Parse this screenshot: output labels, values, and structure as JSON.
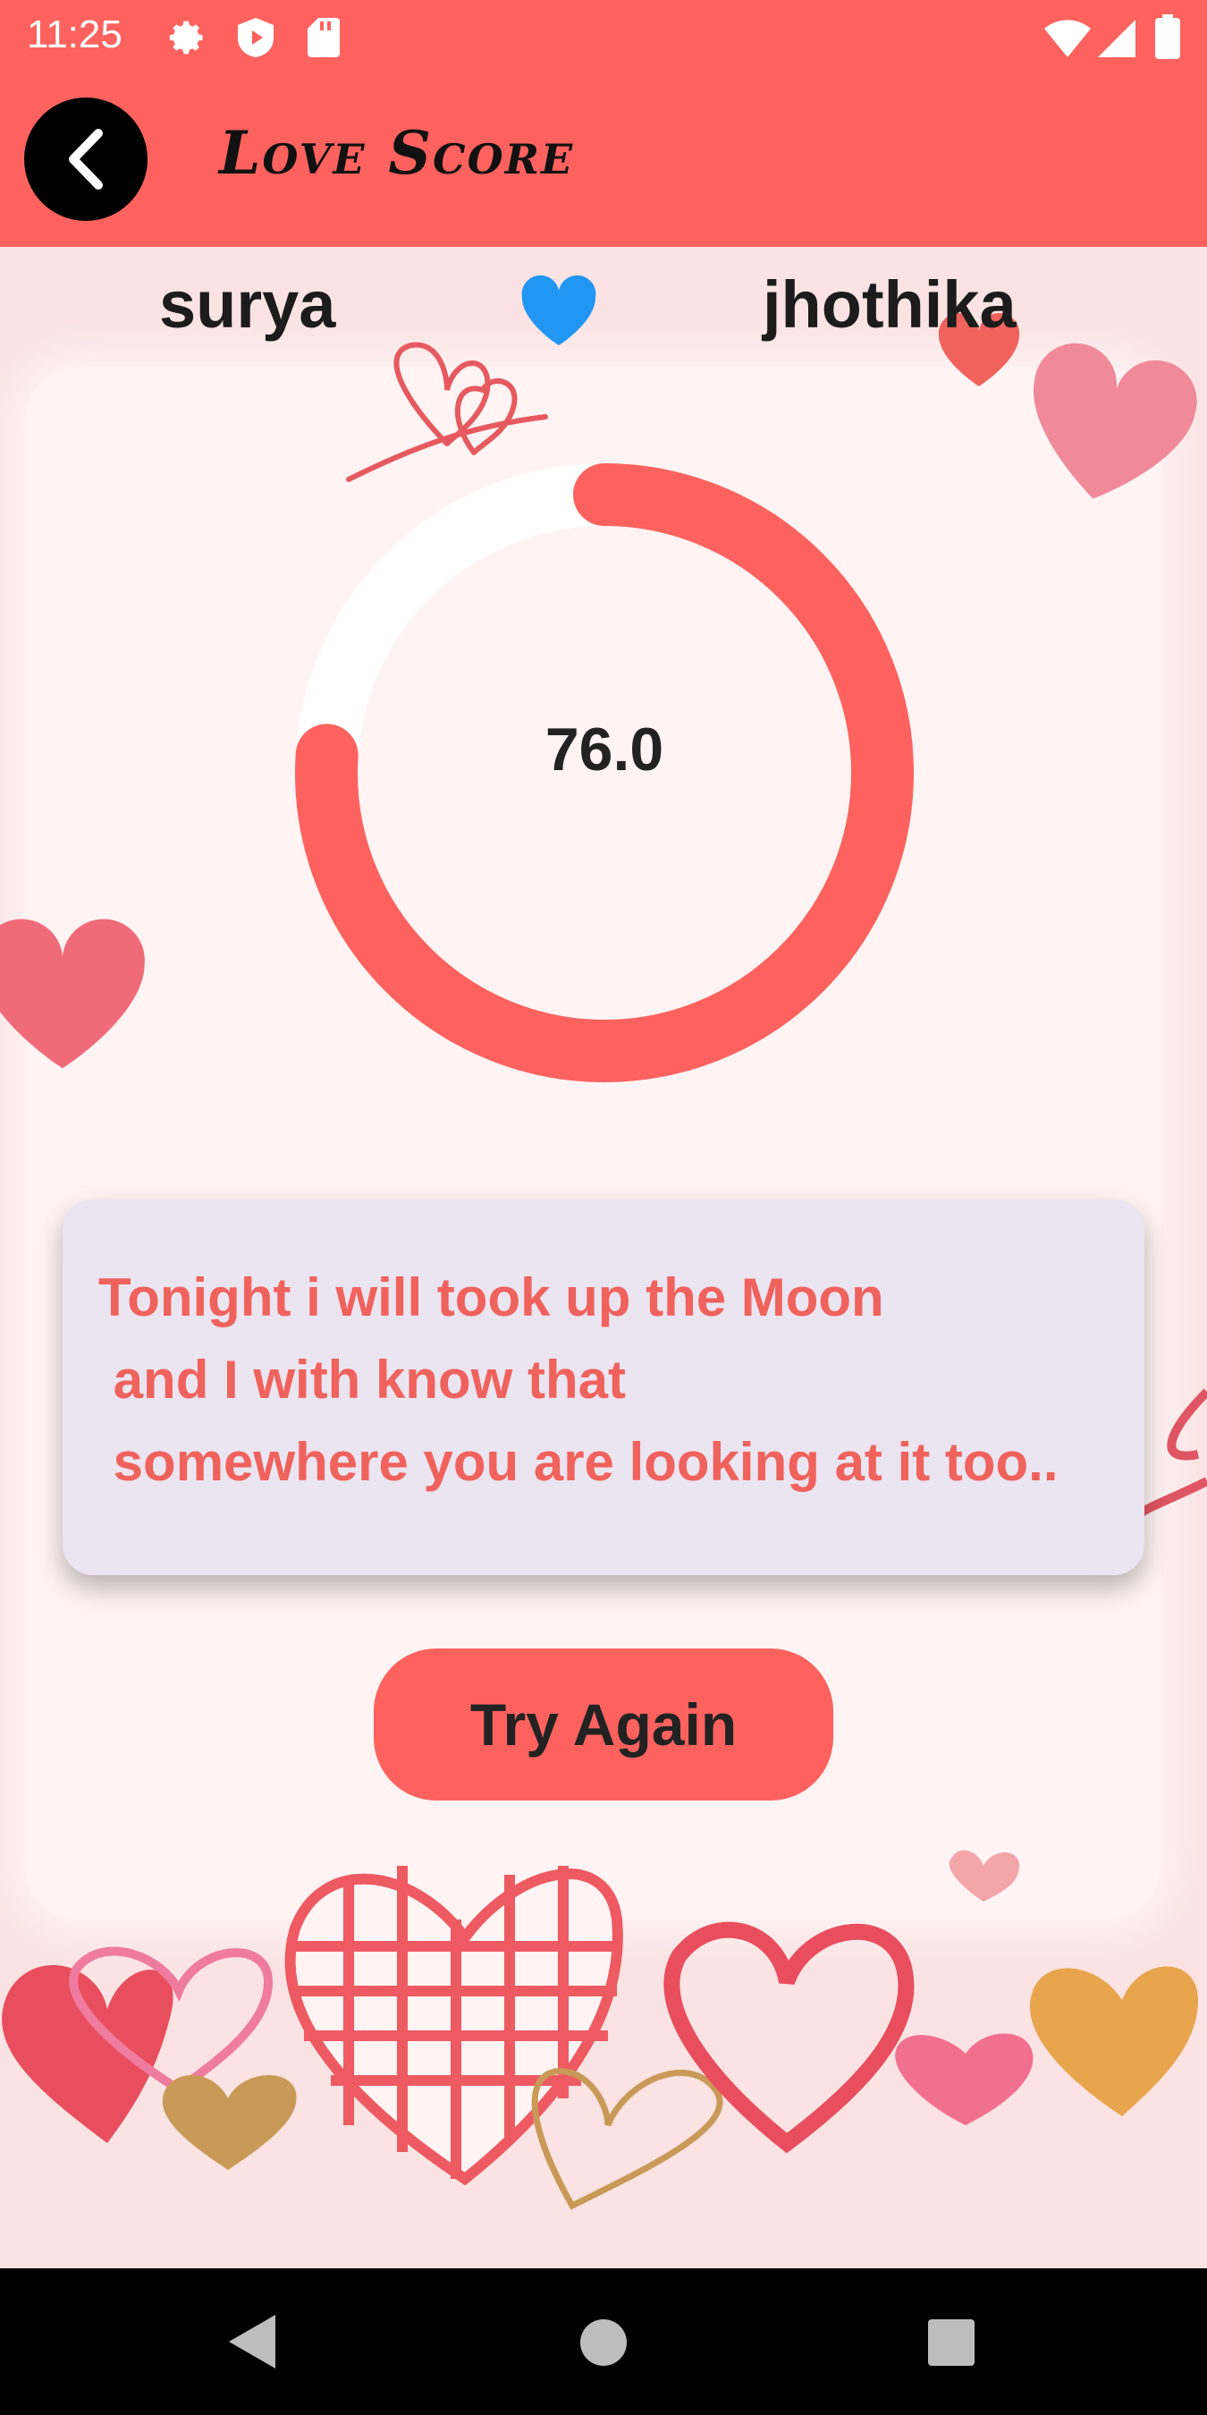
{
  "status_bar": {
    "time": "11:25",
    "icons": [
      "settings-icon",
      "play-protect-icon",
      "sd-card-icon",
      "wifi-icon",
      "signal-icon",
      "battery-icon"
    ]
  },
  "app_bar": {
    "title": "Love Score",
    "back_icon": "back-arrow-icon"
  },
  "names": {
    "left": "surya",
    "right": "jhothika",
    "heart_icon": "heart-icon",
    "heart_color": "#2196f3"
  },
  "score": {
    "value_text": "76.0",
    "fraction": 0.76
  },
  "quote": {
    "line1": "Tonight i will took up the Moon",
    "line2": " and I with know that",
    "line3": " somewhere you are looking at it too.."
  },
  "actions": {
    "try_again_label": "Try Again"
  },
  "colors": {
    "accent": "#fd625e",
    "quote_text": "#f0625c",
    "quote_bg": "#ebe4f1"
  },
  "nav": {
    "icons": [
      "back-icon",
      "home-icon",
      "recents-icon"
    ]
  }
}
